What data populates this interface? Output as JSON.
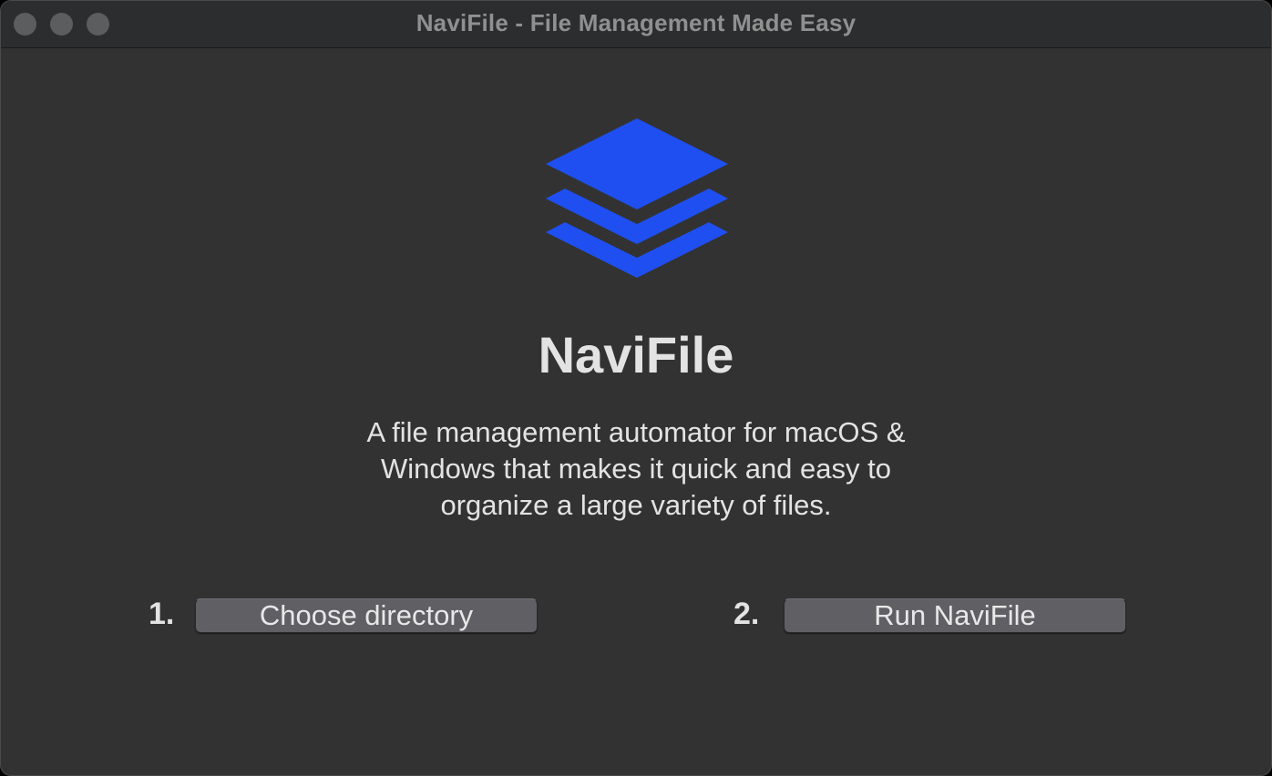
{
  "window": {
    "title": "NaviFile - File Management Made Easy"
  },
  "logo": {
    "icon": "stacked-layers-icon",
    "color": "#1f4ff0"
  },
  "app": {
    "name": "NaviFile",
    "tagline_lines": [
      "A file management automator for macOS &",
      "Windows that makes it quick and easy to",
      "organize a large variety of files."
    ]
  },
  "steps": [
    {
      "number": "1.",
      "button_label": "Choose directory"
    },
    {
      "number": "2.",
      "button_label": "Run NaviFile"
    }
  ],
  "colors": {
    "background": "#323232",
    "titlebar": "#2b2d2e",
    "text": "#e3e3e3",
    "button": "#605f64"
  }
}
